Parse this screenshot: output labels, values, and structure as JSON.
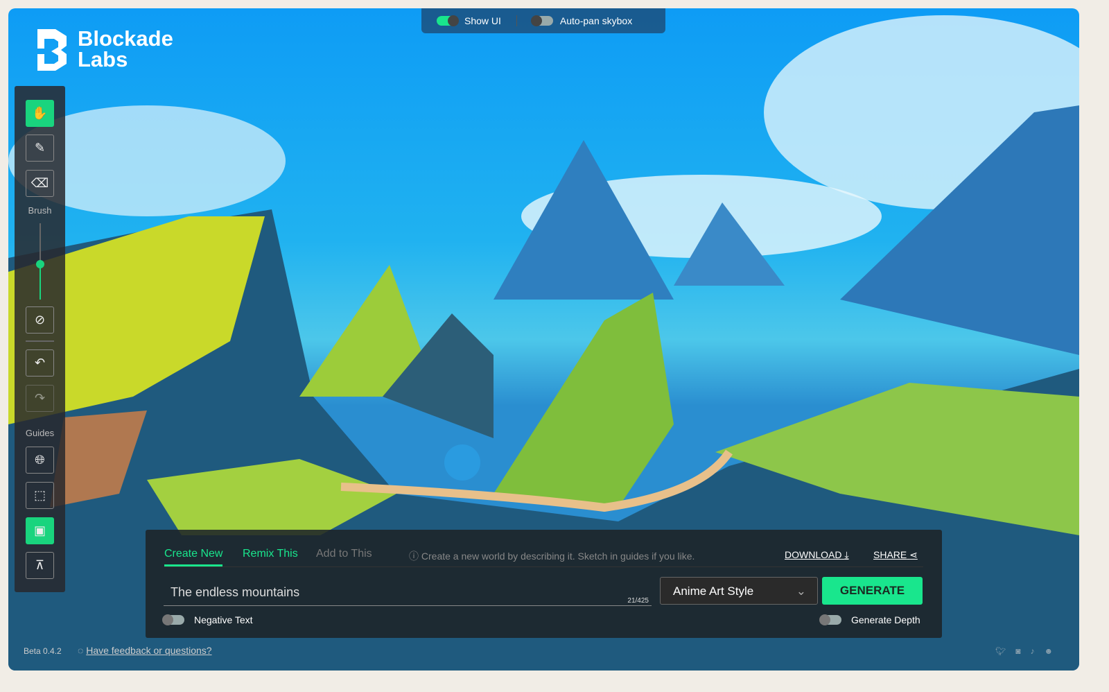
{
  "topbar": {
    "show_ui": "Show UI",
    "show_ui_on": true,
    "autopan": "Auto-pan skybox",
    "autopan_on": false
  },
  "logo": {
    "line1": "Blockade",
    "line2": "Labs"
  },
  "toolbar": {
    "brush_label": "Brush",
    "guides_label": "Guides",
    "brush_size": 0.45,
    "accent": "#19d47e",
    "tools": [
      "hand-icon",
      "brush-icon",
      "eraser-icon",
      "clear-icon",
      "undo-icon",
      "redo-icon",
      "globe-icon",
      "cube-icon",
      "image-icon",
      "perspective-icon"
    ]
  },
  "panel": {
    "tabs": [
      "Create New",
      "Remix This",
      "Add to This"
    ],
    "active_tab": "Create New",
    "hint": "Create a new world by describing it. Sketch in guides if you like.",
    "download": "DOWNLOAD",
    "share": "SHARE",
    "prompt": "The endless mountains",
    "count": "21/425",
    "style": "Anime Art Style",
    "generate": "GENERATE",
    "negative_text": "Negative Text",
    "generate_depth": "Generate Depth"
  },
  "footer": {
    "version": "Beta 0.4.2",
    "feedback": "Have feedback or questions?"
  },
  "social": [
    "twitter-icon",
    "instagram-icon",
    "tiktok-icon",
    "discord-icon"
  ]
}
